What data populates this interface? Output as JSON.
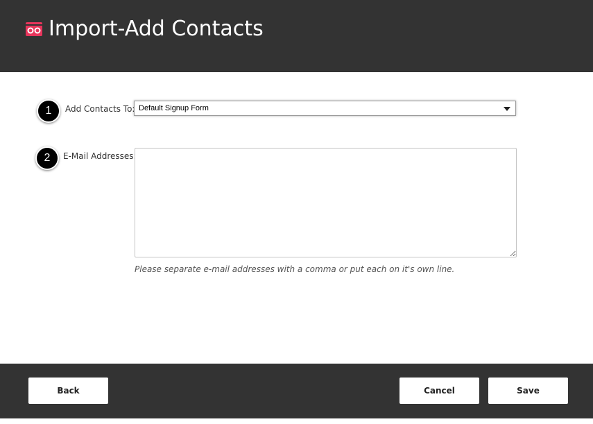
{
  "header": {
    "title": "Import-Add Contacts",
    "brand_color": "#e8355c",
    "logo_icon": "glasses-logo-icon"
  },
  "form": {
    "steps": [
      "1",
      "2"
    ],
    "add_to_label": "Add Contacts To:",
    "add_to_value": "Default Signup Form",
    "emails_label": "E-Mail Addresses:",
    "emails_value": "",
    "emails_hint": "Please separate e-mail addresses with a comma or put each on it's own line."
  },
  "footer": {
    "back_label": "Back",
    "cancel_label": "Cancel",
    "save_label": "Save"
  }
}
